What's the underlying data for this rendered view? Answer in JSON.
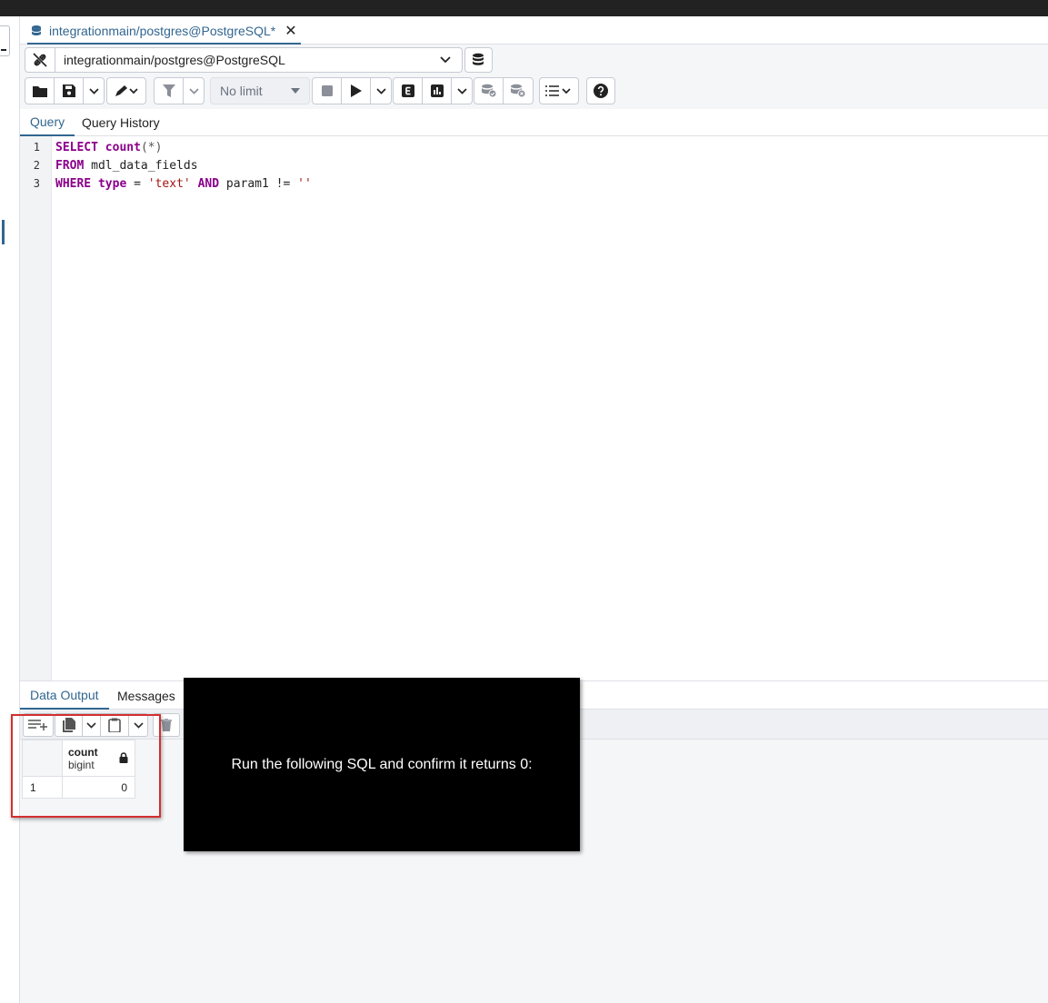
{
  "tab": {
    "title": "integrationmain/postgres@PostgreSQL*",
    "close_symbol": "✕"
  },
  "connection": {
    "selected": "integrationmain/postgres@PostgreSQL"
  },
  "toolbar": {
    "limit_value": "No limit"
  },
  "query_tabs": [
    "Query",
    "Query History"
  ],
  "editor": {
    "line_numbers": [
      "1",
      "2",
      "3"
    ],
    "lines": [
      [
        {
          "t": "SELECT",
          "c": "kw"
        },
        {
          "t": " "
        },
        {
          "t": "count",
          "c": "kw"
        },
        {
          "t": "(*)",
          "c": "punct"
        }
      ],
      [
        {
          "t": "FROM",
          "c": "kw"
        },
        {
          "t": " mdl_data_fields"
        }
      ],
      [
        {
          "t": "WHERE",
          "c": "kw"
        },
        {
          "t": " "
        },
        {
          "t": "type",
          "c": "kw"
        },
        {
          "t": " = "
        },
        {
          "t": "'text'",
          "c": "str"
        },
        {
          "t": " "
        },
        {
          "t": "AND",
          "c": "kw"
        },
        {
          "t": " param1 != "
        },
        {
          "t": "''",
          "c": "str"
        }
      ]
    ]
  },
  "output_tabs": [
    "Data Output",
    "Messages"
  ],
  "result": {
    "column_name": "count",
    "column_type": "bigint",
    "rows": [
      {
        "num": "1",
        "count": "0"
      }
    ]
  },
  "overlay": {
    "text": "Run the following SQL and confirm it returns 0:"
  },
  "colors": {
    "accent": "#326690",
    "highlight": "#d32f2f",
    "keyword": "#8b008b",
    "string": "#a31515"
  }
}
